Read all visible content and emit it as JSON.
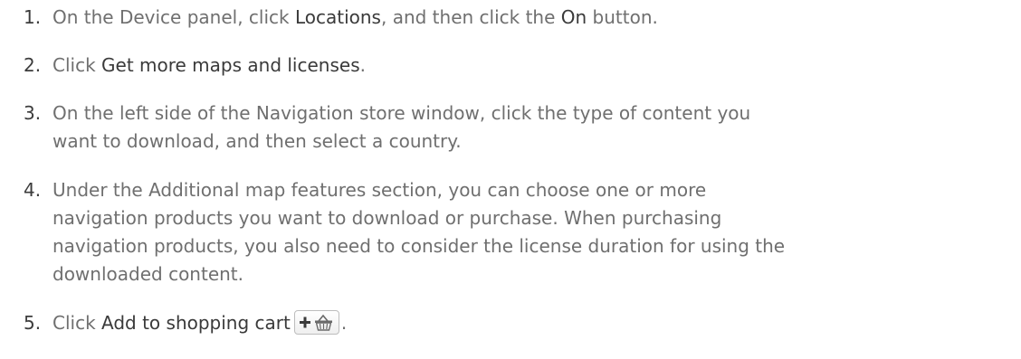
{
  "steps": [
    {
      "number": "1.",
      "parts": [
        "On the Device panel, click ",
        "Locations",
        ", and then click the ",
        "On",
        " button."
      ]
    },
    {
      "number": "2.",
      "parts": [
        "Click ",
        "Get more maps and licenses",
        "."
      ]
    },
    {
      "number": "3.",
      "lines": [
        "On the left side of the Navigation store window, click the type of content you",
        "want to download, and then select a country."
      ]
    },
    {
      "number": "4.",
      "lines": [
        "Under the Additional map features section, you can choose one or more",
        "navigation products you want to download or purchase. When purchasing",
        "navigation products, you also need to consider the license duration for using the",
        "downloaded content."
      ]
    },
    {
      "number": "5.",
      "parts": [
        "Click ",
        "Add to shopping cart",
        "",
        "."
      ],
      "icon": "add-to-cart-icon"
    }
  ]
}
